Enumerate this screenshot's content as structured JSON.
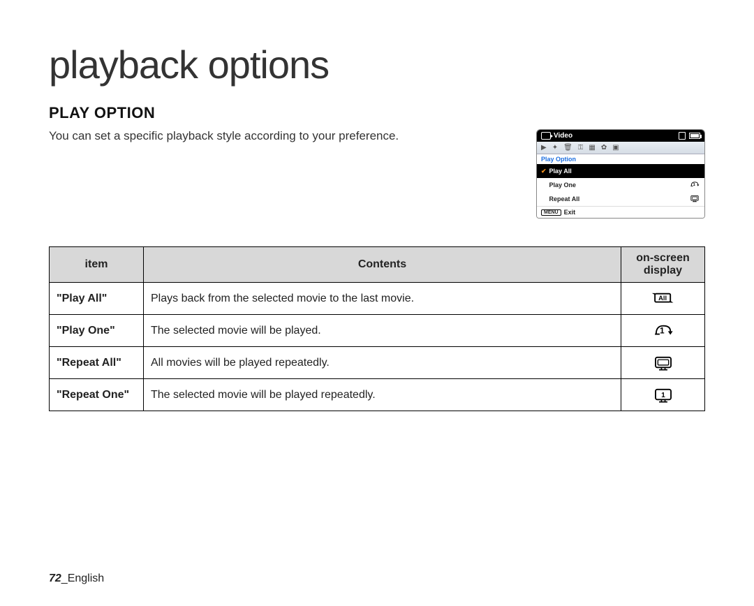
{
  "title": "playback options",
  "section_heading": "PLAY OPTION",
  "description": "You can set a specific playback style according to your preference.",
  "osd": {
    "header_label": "Video",
    "tab_label": "Play Option",
    "items": [
      {
        "label": "Play All",
        "icon": "all-icon",
        "active": true
      },
      {
        "label": "Play One",
        "icon": "one-icon",
        "active": false
      },
      {
        "label": "Repeat All",
        "icon": "repeat-all-icon",
        "active": false
      }
    ],
    "footer_menu": "MENU",
    "footer_text": "Exit"
  },
  "table": {
    "headers": {
      "item": "item",
      "contents": "Contents",
      "display": "on-screen\ndisplay"
    },
    "rows": [
      {
        "item": "\"Play All\"",
        "contents": "Plays back from the selected movie to the last movie.",
        "icon": "all-icon"
      },
      {
        "item": "\"Play One\"",
        "contents": "The selected movie will be played.",
        "icon": "one-icon"
      },
      {
        "item": "\"Repeat All\"",
        "contents": "All movies will be played repeatedly.",
        "icon": "repeat-all-icon"
      },
      {
        "item": "\"Repeat One\"",
        "contents": "The selected movie will be played repeatedly.",
        "icon": "repeat-one-icon"
      }
    ]
  },
  "footer": {
    "page_number": "72",
    "separator": "_",
    "language": "English"
  }
}
